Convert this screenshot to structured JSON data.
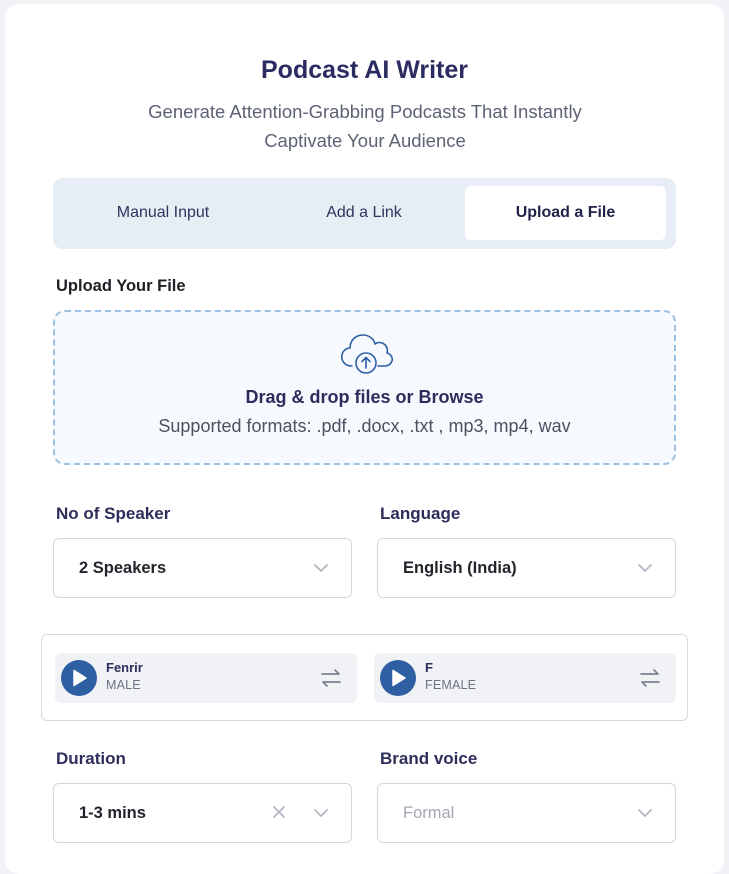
{
  "header": {
    "title": "Podcast AI Writer",
    "subtitle": "Generate Attention-Grabbing Podcasts That Instantly Captivate Your Audience"
  },
  "tabs": [
    {
      "label": "Manual Input",
      "active": false
    },
    {
      "label": "Add a Link",
      "active": false
    },
    {
      "label": "Upload a File",
      "active": true
    }
  ],
  "upload": {
    "label": "Upload Your File",
    "main_text": "Drag & drop files or Browse",
    "formats_text": "Supported formats: .pdf, .docx, .txt , mp3, mp4, wav",
    "icon": "cloud-upload-icon"
  },
  "speakers": {
    "label": "No of Speaker",
    "value": "2 Speakers"
  },
  "language": {
    "label": "Language",
    "value": "English (India)"
  },
  "voices": [
    {
      "name": "Fenrir",
      "gender": "MALE"
    },
    {
      "name": "F",
      "gender": "FEMALE"
    }
  ],
  "duration": {
    "label": "Duration",
    "value": "1-3 mins"
  },
  "brand_voice": {
    "label": "Brand voice",
    "placeholder": "Formal"
  },
  "colors": {
    "accent": "#2e5fa3",
    "title": "#2b2d62",
    "tab_bar": "#e6edf5",
    "dropzone_border": "#9cc0e2"
  }
}
